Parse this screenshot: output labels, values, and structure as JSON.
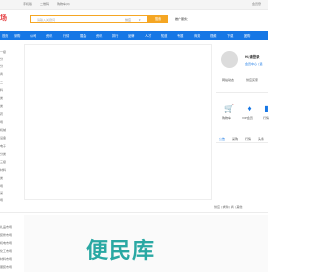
{
  "topbar": {
    "items": [
      "手机版",
      "二维码",
      "购物车(0)"
    ],
    "right": "会员登"
  },
  "header": {
    "logo": "场",
    "search_placeholder": "请输入关键词",
    "category": "供应",
    "search_button": "搜索",
    "ad_label": "推广服务："
  },
  "nav": [
    "首页",
    "采购",
    "公司",
    "资讯",
    "行情",
    "展会",
    "资讯",
    "排行",
    "品牌",
    "人才",
    "知道",
    "专题",
    "商务",
    "视频",
    "下载",
    "团购"
  ],
  "sidebar": [
    "一级",
    "分",
    "分",
    "商",
    "二",
    "料",
    "类",
    "类",
    "药",
    "场",
    "机械",
    "设备",
    "电子",
    "分类",
    "三级",
    "材料",
    "类",
    "场",
    "采",
    "场"
  ],
  "user": {
    "greeting": "Hi,请登录",
    "member_links": "会员中心 | 退",
    "links": [
      "网站动态",
      "供应买家"
    ],
    "quick": [
      "购物车",
      "VIP会员",
      "行情"
    ],
    "tabs": [
      "公告",
      "采购",
      "行情",
      "头条"
    ]
  },
  "pager": "供应 | 求购 | 商 | 其他",
  "lower_sidebar": [
    "礼品市场",
    "装修市场",
    "机电市场",
    "化工市场",
    "材料市场",
    "服装市场"
  ],
  "brand": "便民库",
  "colors": {
    "accent": "#1677e5",
    "search_border": "#f5a623",
    "brand": "#2aa8a3",
    "logo": "#e4393c"
  }
}
